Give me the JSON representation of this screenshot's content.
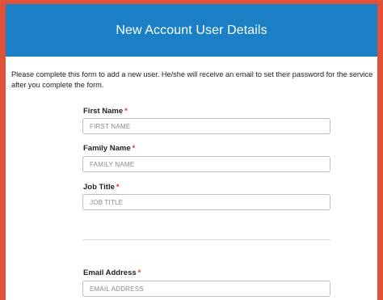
{
  "header": {
    "title": "New Account User Details"
  },
  "intro": "Please complete this form to add a new user. He/she will receive an email to set their password for the service after you complete the form.",
  "fields": [
    {
      "label": "First Name",
      "required_mark": "*",
      "placeholder": "FIRST NAME",
      "value": ""
    },
    {
      "label": "Family Name",
      "required_mark": "*",
      "placeholder": "FAMILY NAME",
      "value": ""
    },
    {
      "label": "Job Title",
      "required_mark": "*",
      "placeholder": "JOB TITLE",
      "value": ""
    },
    {
      "label": "Email Address",
      "required_mark": "*",
      "placeholder": "EMAIL ADDRESS",
      "value": ""
    }
  ],
  "colors": {
    "header_bg": "#1a7fc4",
    "frame_border": "#e0533a",
    "required": "#e23b2e"
  }
}
